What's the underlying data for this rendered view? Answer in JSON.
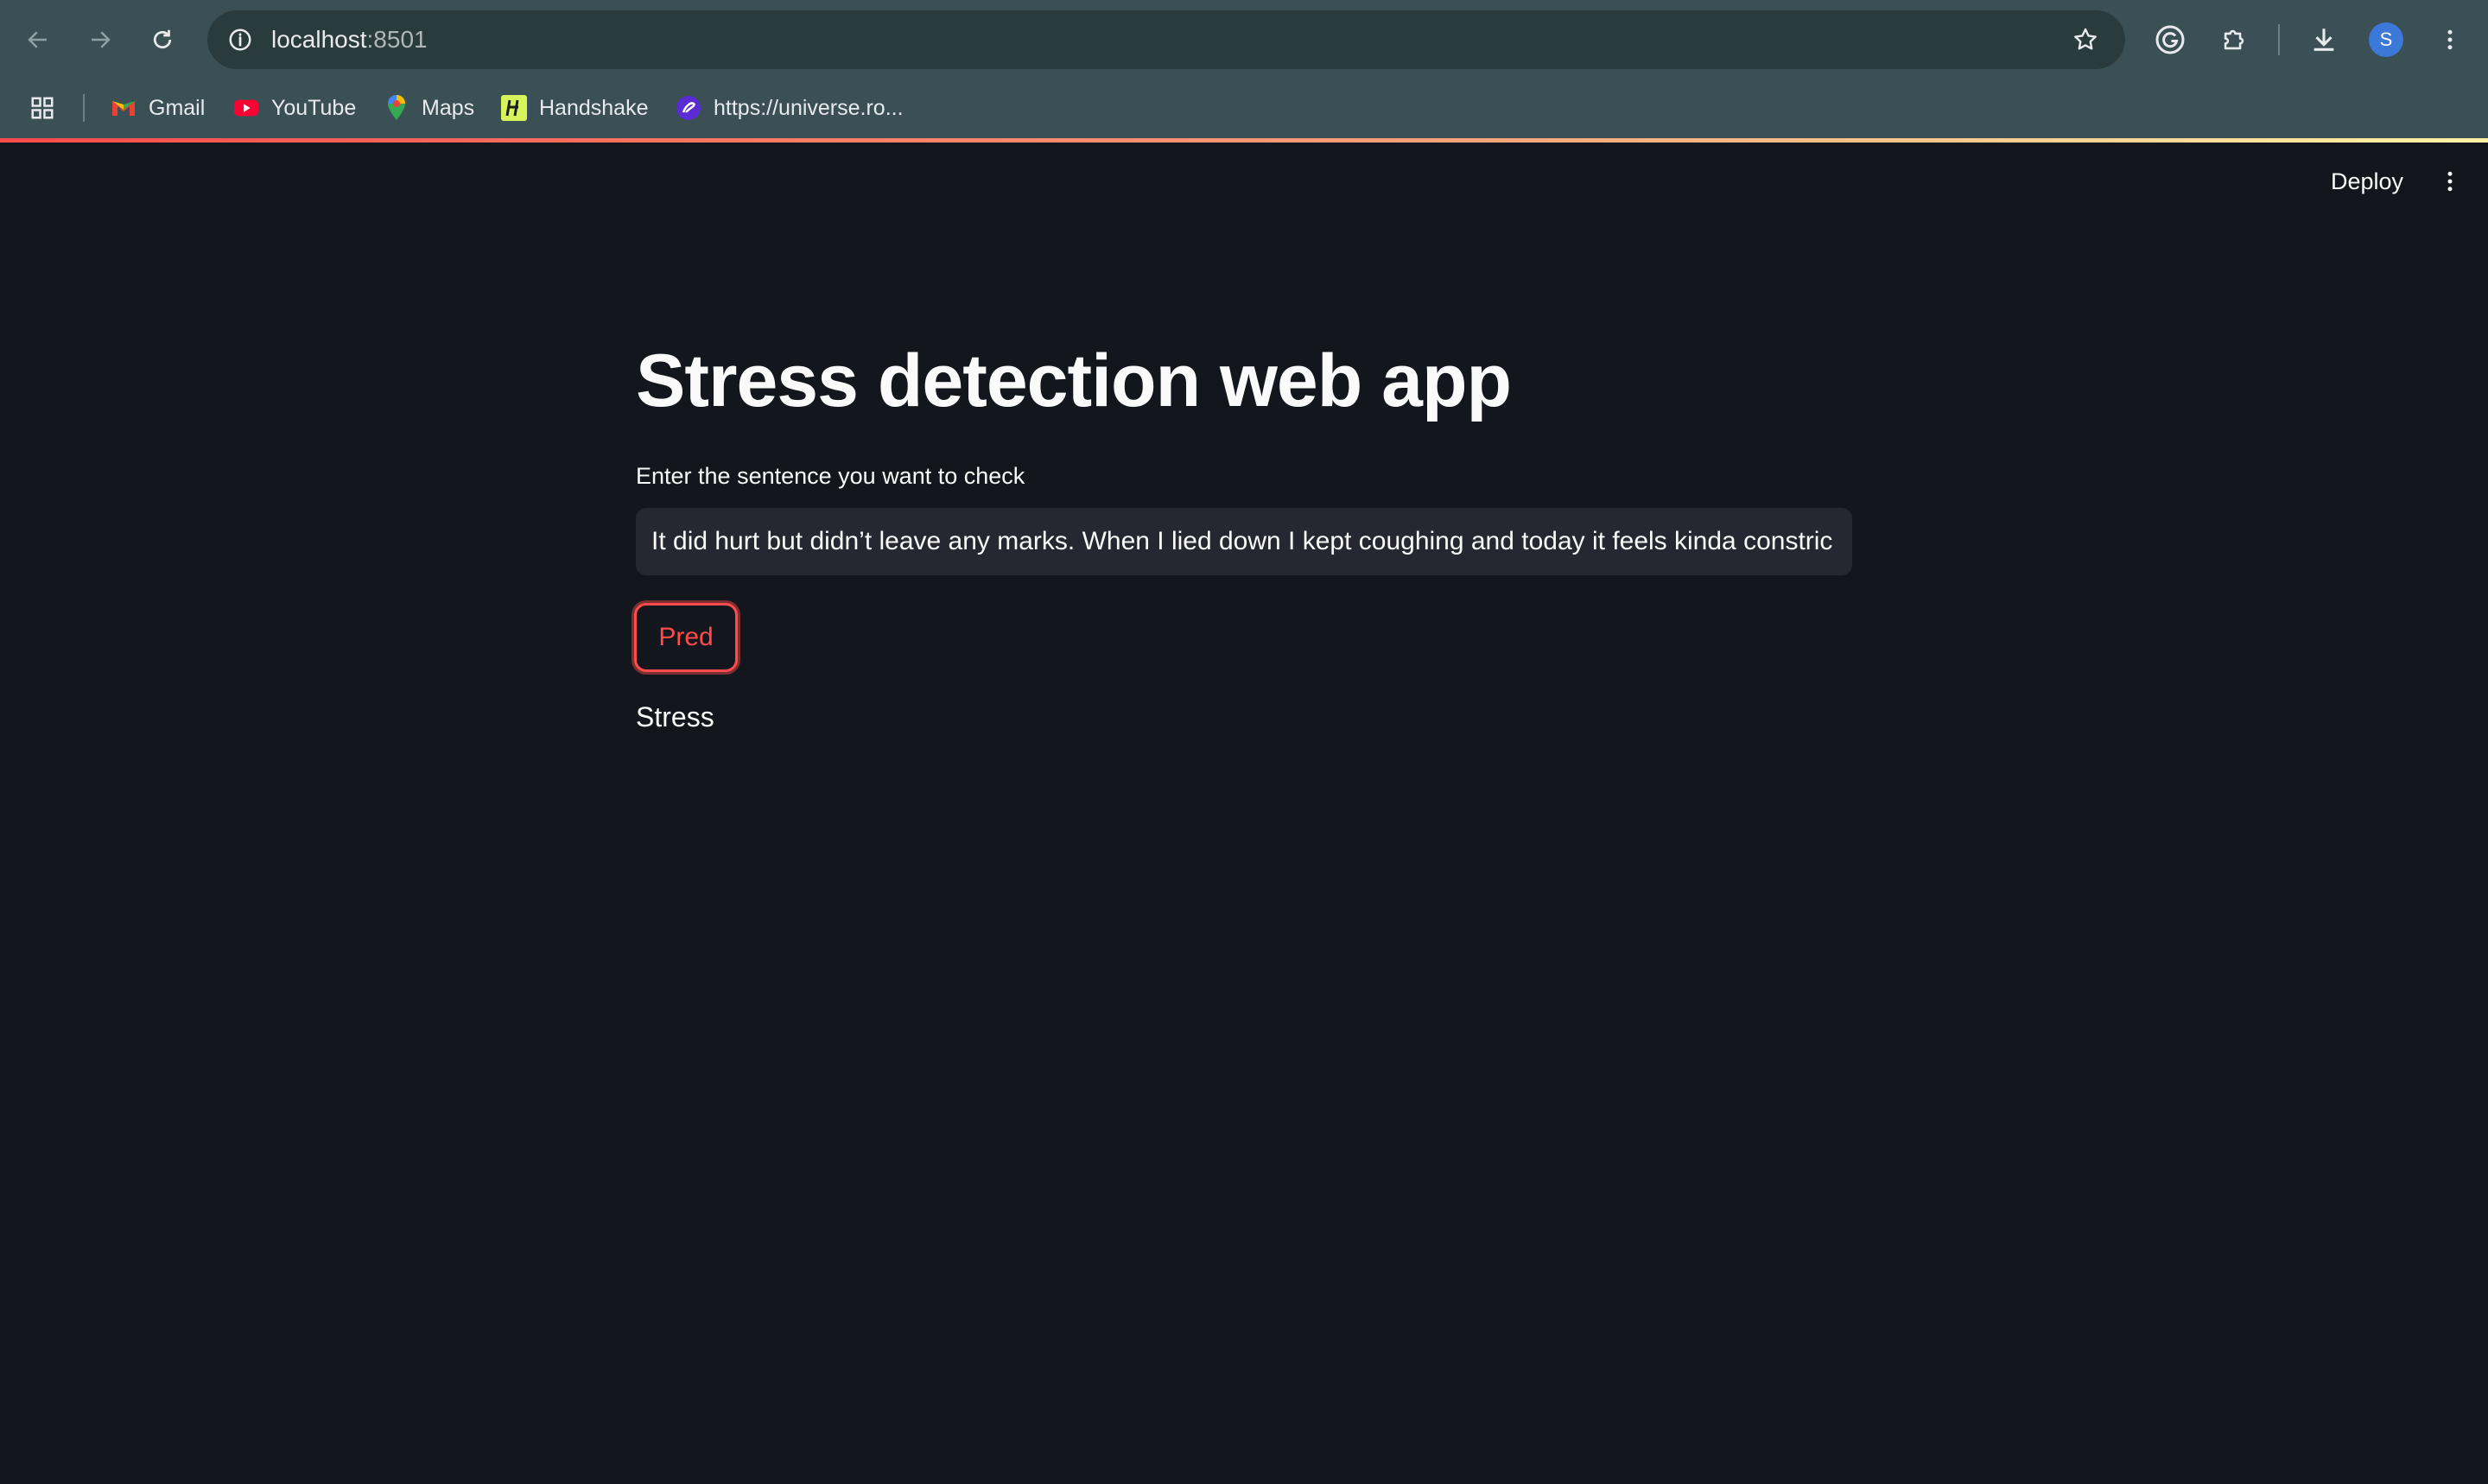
{
  "browser": {
    "url_host": "localhost",
    "url_port": ":8501",
    "profile_initial": "S",
    "bookmarks": [
      {
        "label": "Gmail",
        "icon": "gmail-icon"
      },
      {
        "label": "YouTube",
        "icon": "youtube-icon"
      },
      {
        "label": "Maps",
        "icon": "maps-icon"
      },
      {
        "label": "Handshake",
        "icon": "handshake-icon"
      },
      {
        "label": "https://universe.ro...",
        "icon": "universe-icon"
      }
    ]
  },
  "app": {
    "deploy_label": "Deploy",
    "title": "Stress detection web app",
    "input_label": "Enter the sentence you want to check",
    "input_value": "It did hurt but didn’t leave any marks. When I lied down I kept coughing and today it feels kinda constric",
    "button_label": "Pred",
    "result": "Stress"
  },
  "colors": {
    "background": "#13161c",
    "chrome": "#3b5054",
    "accent": "#ff4b4b",
    "input_bg": "#262730"
  }
}
